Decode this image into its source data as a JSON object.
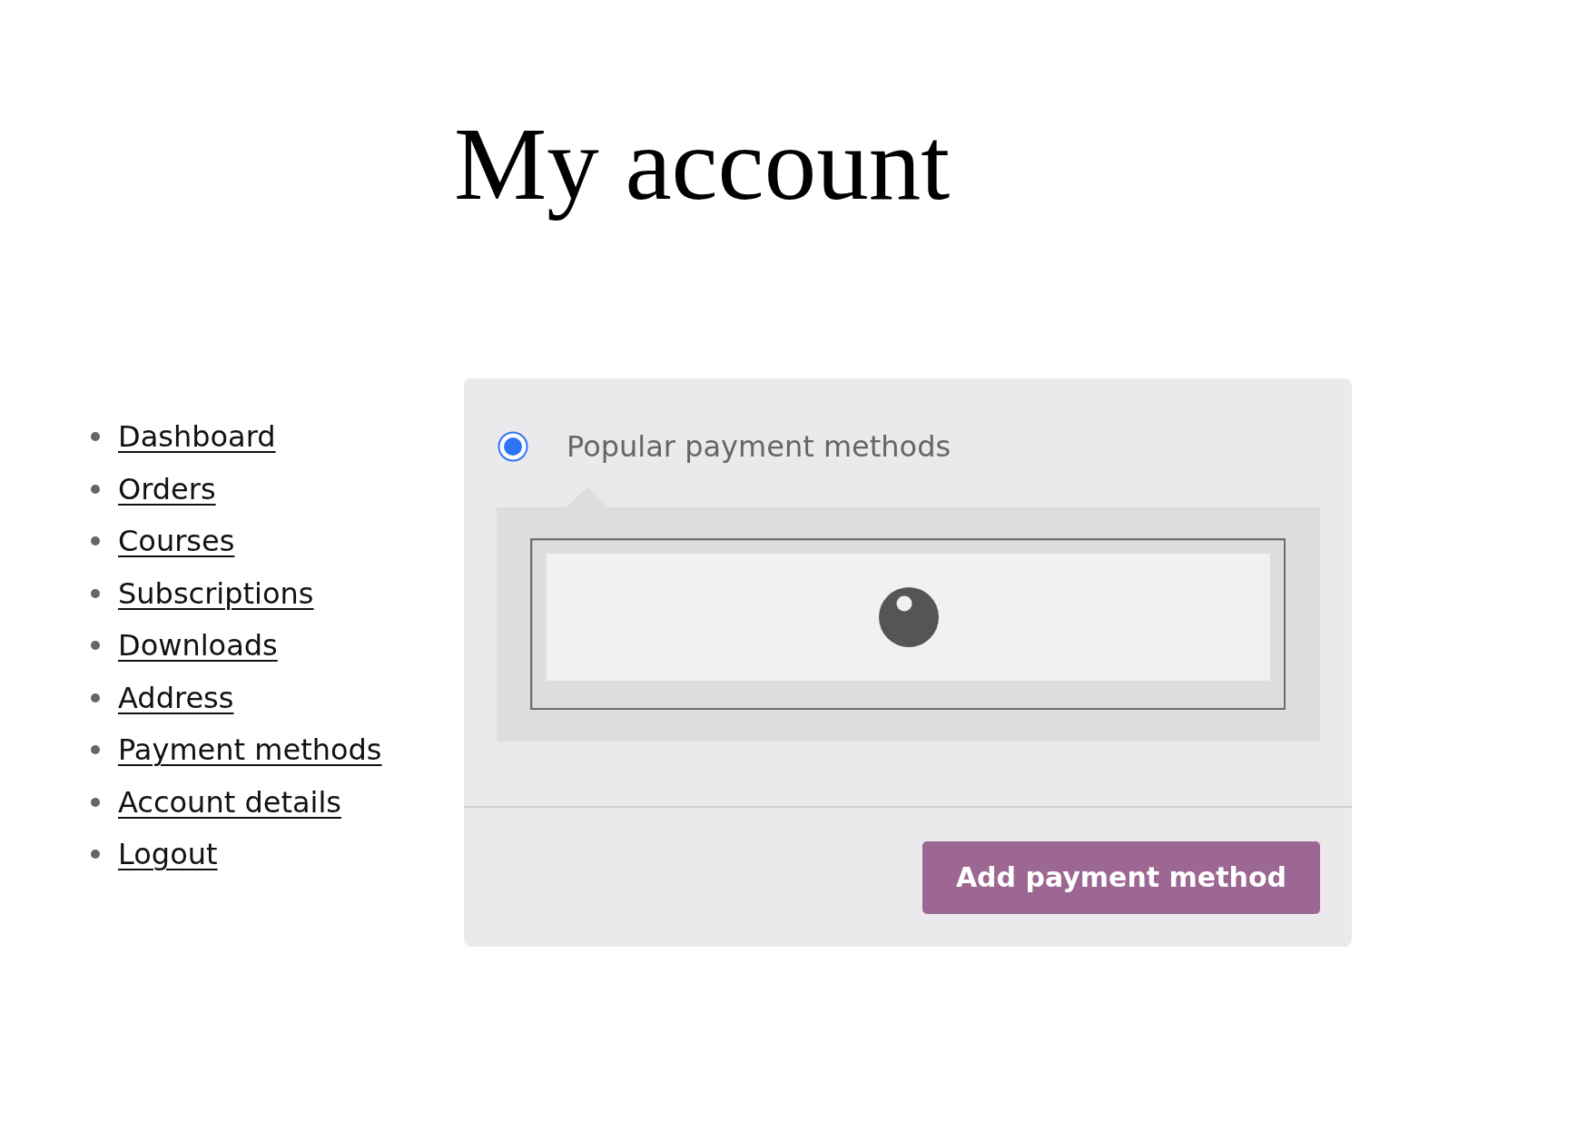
{
  "page": {
    "title": "My account"
  },
  "account_nav": {
    "items": [
      {
        "label": "Dashboard"
      },
      {
        "label": "Orders"
      },
      {
        "label": "Courses"
      },
      {
        "label": "Subscriptions"
      },
      {
        "label": "Downloads"
      },
      {
        "label": "Address"
      },
      {
        "label": "Payment methods"
      },
      {
        "label": "Account details"
      },
      {
        "label": "Logout"
      }
    ]
  },
  "payment_form": {
    "methods": [
      {
        "label": "Popular payment methods",
        "selected": true
      }
    ],
    "card_frame": {
      "loading": true
    },
    "submit_button": "Add payment method"
  }
}
